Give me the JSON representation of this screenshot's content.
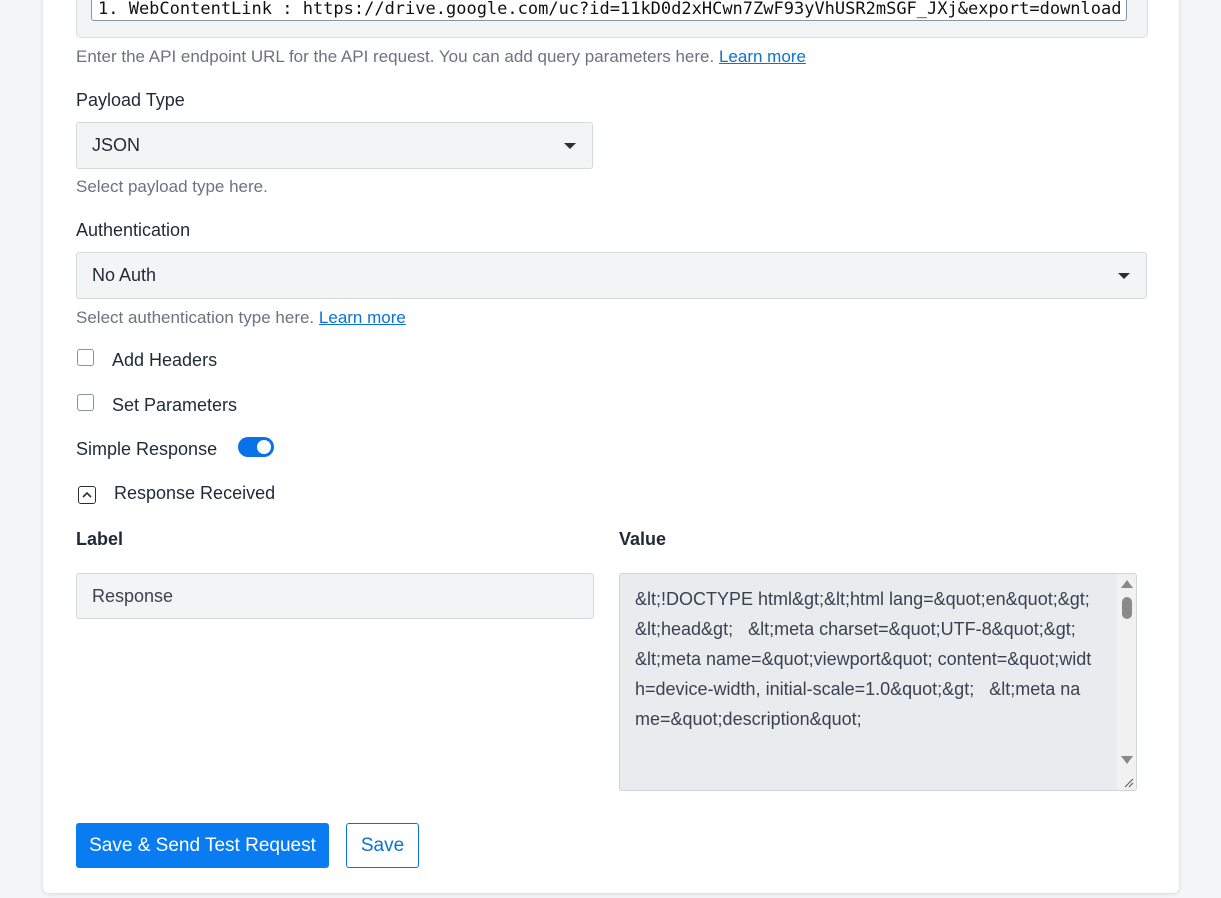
{
  "api_url": {
    "value": "1. WebContentLink : https://drive.google.com/uc?id=11kD0d2xHCwn7ZwF93yVhUSR2mSGF_JXj&export=download",
    "help": "Enter the API endpoint URL for the API request. You can add query parameters here.",
    "learn_more": "Learn more"
  },
  "payload_type": {
    "label": "Payload Type",
    "value": "JSON",
    "help": "Select payload type here."
  },
  "authentication": {
    "label": "Authentication",
    "value": "No Auth",
    "help": "Select authentication type here.",
    "learn_more": "Learn more"
  },
  "add_headers": {
    "label": "Add Headers",
    "checked": false
  },
  "set_parameters": {
    "label": "Set Parameters",
    "checked": false
  },
  "simple_response": {
    "label": "Simple Response",
    "enabled": true
  },
  "response_received": {
    "label": "Response Received",
    "expanded": true
  },
  "mapping": {
    "label_header": "Label",
    "value_header": "Value",
    "label_value": "Response",
    "value_text": "&lt;!DOCTYPE html&gt;&lt;html lang=&quot;en&quot;&gt;&lt;head&gt;   &lt;meta charset=&quot;UTF-8&quot;&gt;   &lt;meta name=&quot;viewport&quot; content=&quot;width=device-width, initial-scale=1.0&quot;&gt;   &lt;meta name=&quot;description&quot;"
  },
  "buttons": {
    "save_and_send": "Save & Send Test Request",
    "save": "Save"
  },
  "colors": {
    "accent": "#0a7cf2",
    "link": "#0a72d6",
    "toggle_on": "#0a72e8"
  }
}
